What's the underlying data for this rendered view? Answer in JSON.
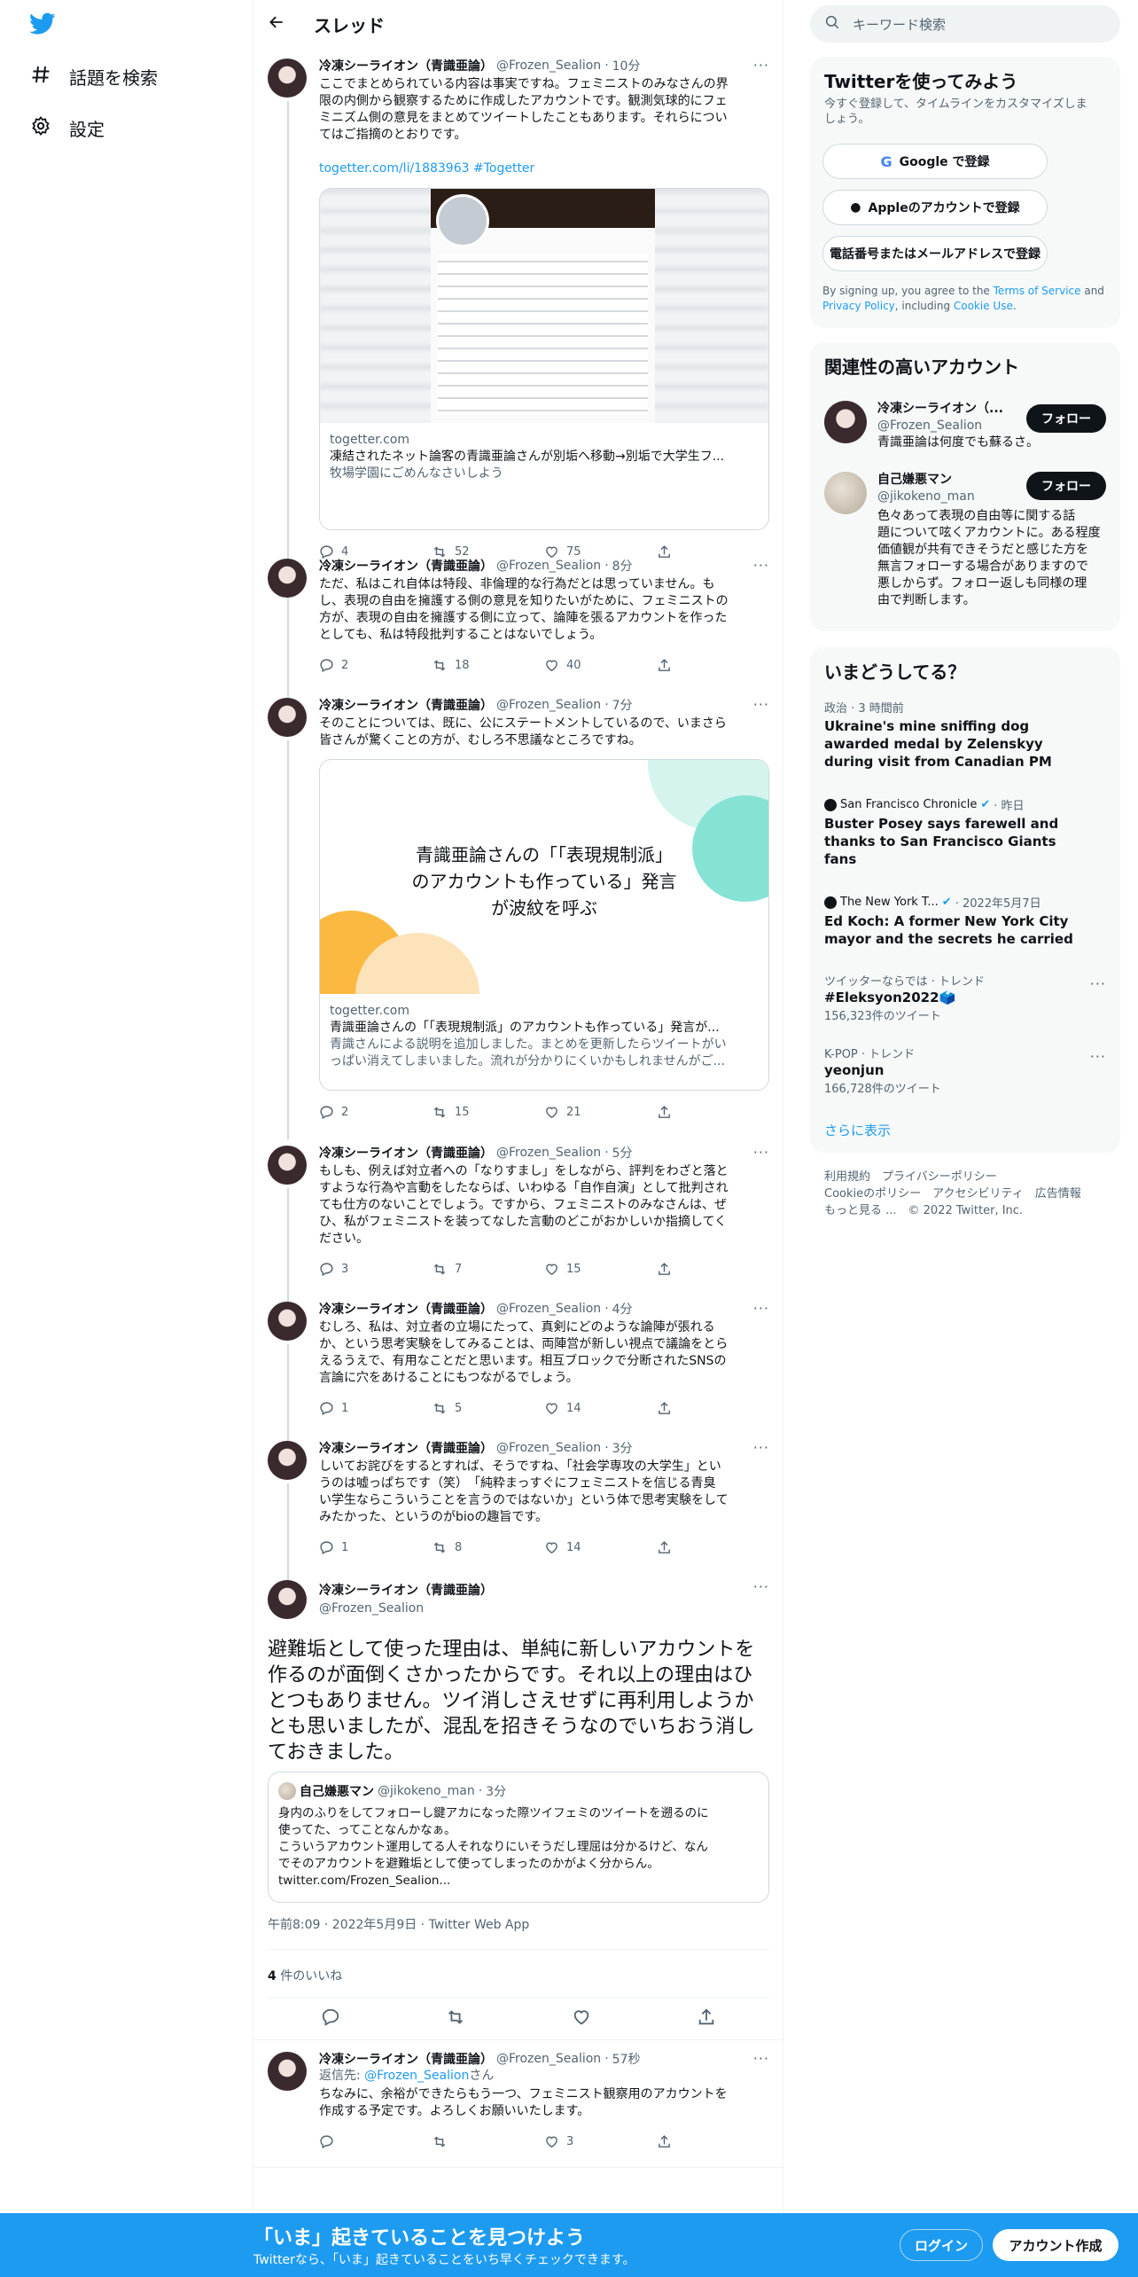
{
  "nav": {
    "explore": "話題を検索",
    "settings": "設定"
  },
  "header": {
    "title": "スレッド"
  },
  "user": {
    "name": "冷凍シーライオン（青識亜論）",
    "handle": "@Frozen_Sealion"
  },
  "tweets": [
    {
      "time": "10分",
      "text": "ここでまとめられている内容は事実ですね。フェミニストのみなさんの界\n限の内側から観察するために作成したアカウントです。観測気球的にフェ\nミニズム側の意見をまとめてツイートしたこともあります。それらについ\nてはご指摘のとおりです。",
      "link": "togetter.com/li/1883963 #Togetter",
      "card": {
        "domain": "togetter.com",
        "title": "凍結されたネット論客の青識亜論さんが別垢へ移動→別垢で大学生フ...",
        "desc": "牧場学園にごめんなさいしよう"
      },
      "replies": "4",
      "retweets": "52",
      "likes": "75"
    },
    {
      "time": "8分",
      "text": "ただ、私はこれ自体は特段、非倫理的な行為だとは思っていません。も\nし、表現の自由を擁護する側の意見を知りたいがために、フェミニストの\n方が、表現の自由を擁護する側に立って、論陣を張るアカウントを作った\nとしても、私は特段批判することはないでしょう。",
      "replies": "2",
      "retweets": "18",
      "likes": "40"
    },
    {
      "time": "7分",
      "text": "そのことについては、既に、公にステートメントしているので、いまさら\n皆さんが驚くことの方が、むしろ不思議なところですね。",
      "card": {
        "image_text": "青識亜論さんの「「表現規制派」\nのアカウントも作っている」発言\nが波紋を呼ぶ",
        "domain": "togetter.com",
        "title": "青識亜論さんの「「表現規制派」のアカウントも作っている」発言が...",
        "desc": "青識さんによる説明を追加しました。まとめを更新したらツイートがい\nっぱい消えてしまいました。流れが分かりにくいかもしれませんがご..."
      },
      "replies": "2",
      "retweets": "15",
      "likes": "21"
    },
    {
      "time": "5分",
      "text": "もしも、例えば対立者への「なりすまし」をしながら、評判をわざと落と\nすような行為や言動をしたならば、いわゆる「自作自演」として批判され\nても仕方のないことでしょう。ですから、フェミニストのみなさんは、ぜ\nひ、私がフェミニストを装ってなした言動のどこがおかしいか指摘してく\nださい。",
      "replies": "3",
      "retweets": "7",
      "likes": "15"
    },
    {
      "time": "4分",
      "text": "むしろ、私は、対立者の立場にたって、真剣にどのような論陣が張れる\nか、という思考実験をしてみることは、両陣営が新しい視点で議論をとら\nえるうえで、有用なことだと思います。相互ブロックで分断されたSNSの\n言論に穴をあけることにもつながるでしょう。",
      "replies": "1",
      "retweets": "5",
      "likes": "14"
    },
    {
      "time": "3分",
      "text": "しいてお詫びをするとすれば、そうですね、「社会学専攻の大学生」とい\nうのは嘘っぱちです（笑）　「純粋まっすぐにフェミニストを信じる青臭\nい学生ならこういうことを言うのではないか」という体で思考実験をして\nみたかった、というのがbioの趣旨です。",
      "replies": "1",
      "retweets": "8",
      "likes": "14"
    }
  ],
  "main_tweet": {
    "text": "避難垢として使った理由は、単純に新しいアカウントを作るのが面倒くさかったからです。それ以上の理由はひとつもありません。ツイ消しさえせずに再利用しようかとも思いましたが、混乱を招きそうなのでいちおう消しておきました。",
    "quote": {
      "name": "自己嫌悪マン",
      "handle": "@jikokeno_man",
      "time": "3分",
      "text": "身内のふりをしてフォローし鍵アカになった際ツイフェミのツイートを遡るのに\n使ってた、ってことなんかなぁ。\nこういうアカウント運用してる人それなりにいそうだし理屈は分かるけど、なん\nでそのアカウントを避難垢として使ってしまったのかがよく分からん。\ntwitter.com/Frozen_Sealion..."
    },
    "timestamp": "午前8:09 · 2022年5月9日 · Twitter Web App",
    "likes_count": "4",
    "likes_label": "件のいいね"
  },
  "reply": {
    "time": "57秒",
    "reply_to_prefix": "返信先: ",
    "reply_to_handle": "@Frozen_Sealion",
    "reply_to_suffix": "さん",
    "text": "ちなみに、余裕ができたらもう一つ、フェミニスト観察用のアカウントを\n作成する予定です。よろしくお願いいたします。",
    "replies": "",
    "retweets": "",
    "likes": "3"
  },
  "search": {
    "placeholder": "キーワード検索"
  },
  "signup": {
    "title": "Twitterを使ってみよう",
    "subtitle": "今すぐ登録して、タイムラインをカスタマイズしま\nしょう。",
    "google": "Google で登録",
    "apple": "Appleのアカウントで登録",
    "phone": "電話番号またはメールアドレスで登録",
    "terms_pre": "By signing up, you agree to the ",
    "terms": "Terms of Service",
    "terms_mid": " and\n",
    "privacy": "Privacy Policy",
    "terms_mid2": ", including ",
    "cookie": "Cookie Use",
    "terms_end": "."
  },
  "relevant": {
    "title": "関連性の高いアカウント",
    "accounts": [
      {
        "name": "冷凍シーライオン（...",
        "handle": "@Frozen_Sealion",
        "bio": "青識亜論は何度でも蘇るさ。",
        "follow": "フォロー"
      },
      {
        "name": "自己嫌悪マン",
        "handle": "@jikokeno_man",
        "bio": "色々あって表現の自由等に関する話\n題について呟くアカウントに。ある程度\n価値観が共有できそうだと感じた方を\n無言フォローする場合がありますので\n悪しからず。フォロー返しも同様の理\n由で判断します。",
        "follow": "フォロー"
      }
    ]
  },
  "trends": {
    "title": "いまどうしてる？",
    "items": [
      {
        "meta": "政治 · 3 時間前",
        "text": "Ukraine's mine sniffing dog\nawarded medal by Zelenskyy\nduring visit from Canadian PM"
      },
      {
        "source": "San Francisco Chronicle",
        "meta": " · 昨日",
        "text": "Buster Posey says farewell and\nthanks to San Francisco Giants\nfans"
      },
      {
        "source": "The New York T...",
        "meta": " · 2022年5月7日",
        "text": "Ed Koch: A former New York City\nmayor and the secrets he carried"
      },
      {
        "meta": "ツイッターならでは · トレンド",
        "text": "#Eleksyon2022🗳️",
        "count": "156,323件のツイート"
      },
      {
        "meta": "K-POP · トレンド",
        "text": "yeonjun",
        "count": "166,728件のツイート"
      }
    ],
    "show_more": "さらに表示"
  },
  "footer": {
    "line1": "利用規約　プライバシーポリシー",
    "line2": "Cookieのポリシー　アクセシビリティ　広告情報",
    "line3": "もっと見る ...　© 2022 Twitter, Inc."
  },
  "banner": {
    "title": "「いま」起きていることを見つけよう",
    "subtitle": "Twitterなら、「いま」起きていることをいち早くチェックできます。",
    "login": "ログイン",
    "signup": "アカウント作成"
  },
  "colors": {
    "accent": "#1d9bf0",
    "text": "#0f1419",
    "muted": "#536471"
  }
}
